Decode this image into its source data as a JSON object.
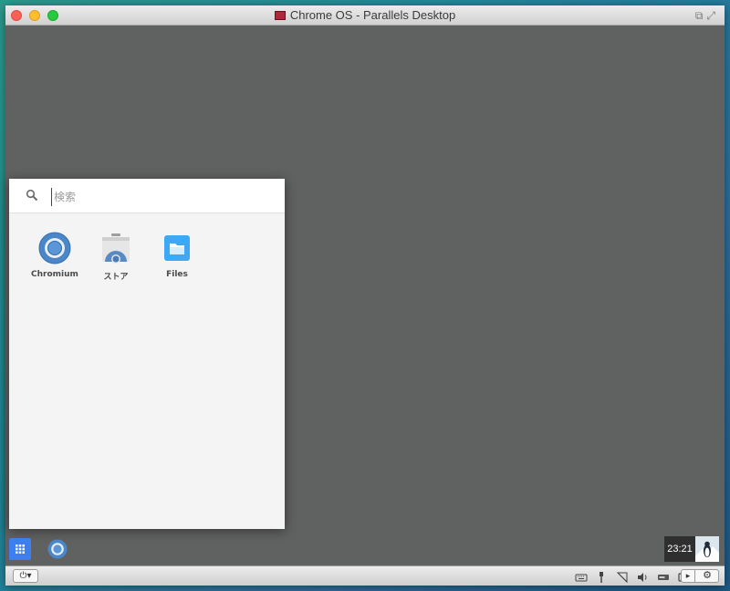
{
  "window": {
    "title": "Chrome OS - Parallels Desktop"
  },
  "launcher": {
    "search_placeholder": "検索",
    "apps": [
      {
        "label": "Chromium",
        "icon": "chromium-icon"
      },
      {
        "label": "ストア",
        "icon": "web-store-icon"
      },
      {
        "label": "Files",
        "icon": "files-folder-icon"
      }
    ]
  },
  "shelf": {
    "clock": "23:21"
  },
  "colors": {
    "launcher_button": "#3d7ef1",
    "desktop_background": "#606261",
    "files_blue": "#3da8f5"
  },
  "bottom_bar": {
    "power_icon": "power-icon",
    "tray_icons": [
      "keyboard-icon",
      "usb-icon",
      "network-icon",
      "volume-icon",
      "drive-icon",
      "device-icon"
    ],
    "right_icons": [
      "play-icon",
      "gear-icon"
    ]
  }
}
